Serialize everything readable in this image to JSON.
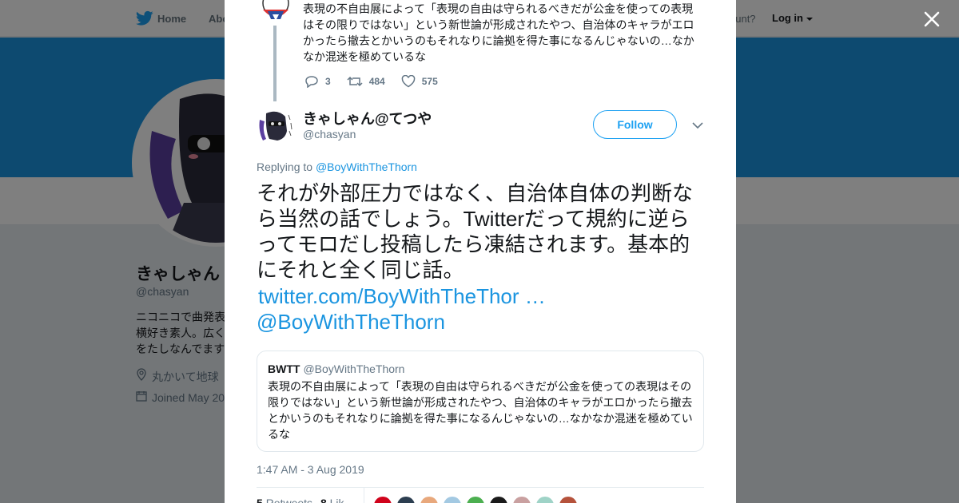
{
  "nav": {
    "home": "Home",
    "about": "Abo",
    "account_question": "ccount?",
    "login": "Log in"
  },
  "profile": {
    "name": "きゃしゃん",
    "handle": "@chasyan",
    "bio": "ニコニコで曲発表 横好き素人。広く をたしなんでます",
    "location": "丸かいて地球",
    "joined": "Joined May 20"
  },
  "parent_tweet": {
    "text": "表現の不自由展によって「表現の自由は守られるべきだが公金を使っての表現はその限りではない」という新世論が形成されたやつ、自治体のキャラがエロかったら撤去とかいうのもそれなりに論拠を得た事になるんじゃないの…なかなか混迷を極めているな",
    "replies": "3",
    "retweets": "484",
    "likes": "575"
  },
  "tweet": {
    "name": "きゃしゃん@てつや",
    "handle": "@chasyan",
    "follow_label": "Follow",
    "replying_prefix": "Replying to",
    "replying_to": "@BoyWithTheThorn",
    "text": "それが外部圧力ではなく、自治体自体の判断なら当然の話でしょう。Twitterだって規約に逆らってモロだし投稿したら凍結されます。基本的にそれと全く同じ話。",
    "link": "twitter.com/BoyWithTheThor …",
    "mention": "@BoyWithTheThorn",
    "timestamp": "1:47 AM - 3 Aug 2019",
    "retweet_count": "5",
    "retweet_label": "Retweets",
    "like_count": "8",
    "like_label": "Lik"
  },
  "quote": {
    "name": "BWTT",
    "handle": "@BoyWithTheThorn",
    "text": "表現の不自由展によって「表現の自由は守られるべきだが公金を使っての表現はその限りではない」という新世論が形成されたやつ、自治体のキャラがエロかったら撤去とかいうのもそれなりに論拠を得た事になるんじゃないの…なかなか混迷を極めているな"
  },
  "colors": {
    "accent": "#1da1f2",
    "link": "#1b95e0",
    "banner": "#1b95e0",
    "text": "#14171a",
    "muted": "#657786"
  },
  "icons": {
    "brand": "twitter-bird-icon",
    "close": "close-icon",
    "reply": "reply-icon",
    "retweet": "retweet-icon",
    "like": "heart-icon",
    "more": "chevron-down-icon",
    "location": "location-pin-icon",
    "calendar": "calendar-icon"
  },
  "liker_colors": [
    "#d0021b",
    "#2c3e50",
    "#e8a87c",
    "#a3c9e2",
    "#4caf50",
    "#1a1a1a",
    "#c9a0a0",
    "#9fd3c7",
    "#b5523b"
  ]
}
